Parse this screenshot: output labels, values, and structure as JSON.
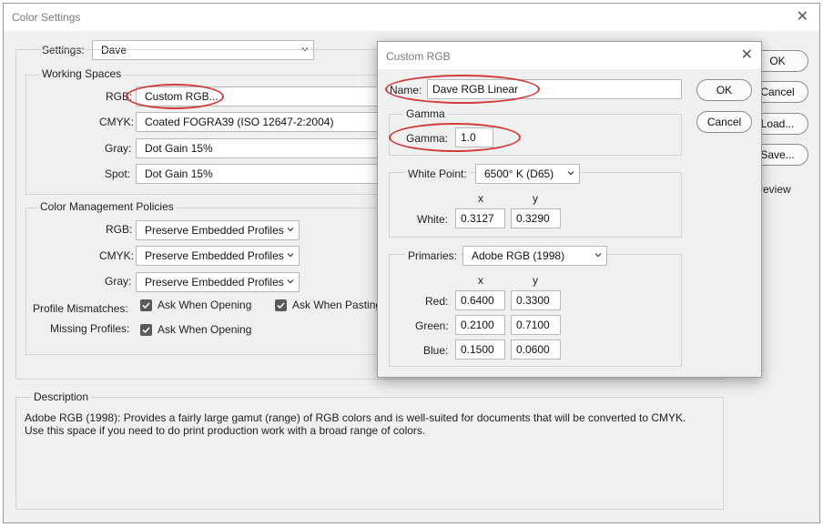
{
  "window": {
    "title": "Color Settings",
    "settings_label": "Settings:",
    "settings_value": "Dave",
    "buttons": {
      "ok": "OK",
      "cancel": "Cancel",
      "load": "Load...",
      "save": "Save...",
      "preview": "Preview"
    }
  },
  "working_spaces": {
    "heading": "Working Spaces",
    "rgb_label": "RGB:",
    "rgb_value": "Custom RGB...",
    "cmyk_label": "CMYK:",
    "cmyk_value": "Coated FOGRA39 (ISO 12647-2:2004)",
    "gray_label": "Gray:",
    "gray_value": "Dot Gain 15%",
    "spot_label": "Spot:",
    "spot_value": "Dot Gain 15%"
  },
  "policies": {
    "heading": "Color Management Policies",
    "rgb_label": "RGB:",
    "rgb_value": "Preserve Embedded Profiles",
    "cmyk_label": "CMYK:",
    "cmyk_value": "Preserve Embedded Profiles",
    "gray_label": "Gray:",
    "gray_value": "Preserve Embedded Profiles",
    "mismatch_label": "Profile Mismatches:",
    "ask_opening": "Ask When Opening",
    "ask_pasting": "Ask When Pasting",
    "missing_label": "Missing Profiles:",
    "missing_ask_opening": "Ask When Opening"
  },
  "description": {
    "heading": "Description",
    "line1": "Adobe RGB (1998):  Provides a fairly large gamut (range) of RGB colors and is well-suited for documents that will be converted to CMYK.",
    "line2": "Use this space if you need to do print production work with a broad range of colors."
  },
  "custom_rgb": {
    "title": "Custom RGB",
    "name_label": "Name:",
    "name_value": "Dave RGB Linear",
    "ok": "OK",
    "cancel": "Cancel",
    "gamma_heading": "Gamma",
    "gamma_label": "Gamma:",
    "gamma_value": "1.0",
    "white_point_label": "White Point:",
    "white_point_value": "6500° K (D65)",
    "col_x": "x",
    "col_y": "y",
    "white_label": "White:",
    "white_x": "0.3127",
    "white_y": "0.3290",
    "primaries_label": "Primaries:",
    "primaries_value": "Adobe RGB (1998)",
    "red_label": "Red:",
    "red_x": "0.6400",
    "red_y": "0.3300",
    "green_label": "Green:",
    "green_x": "0.2100",
    "green_y": "0.7100",
    "blue_label": "Blue:",
    "blue_x": "0.1500",
    "blue_y": "0.0600"
  },
  "icons": {
    "close": "close-icon",
    "chevron": "chevron-down-icon",
    "checkbox": "checkmark-icon"
  },
  "colors": {
    "annotation_ellipse": "#d33a3a",
    "checkbox_fill": "#5a5a5a",
    "window_bg": "#f0f0f0"
  }
}
